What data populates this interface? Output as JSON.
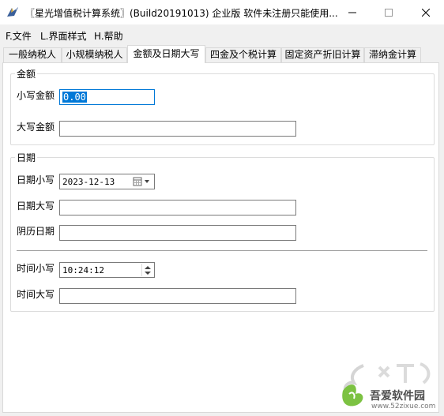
{
  "window": {
    "title": "〖星光增值税计算系统〗(Build20191013) 企业版 软件未注册只能使用...",
    "icon": "app-bird-icon"
  },
  "menu": {
    "items": [
      {
        "label": "F.文件"
      },
      {
        "label": "L.界面样式"
      },
      {
        "label": "H.帮助"
      }
    ]
  },
  "tabs": [
    {
      "label": "一般纳税人",
      "active": false
    },
    {
      "label": "小规模纳税人",
      "active": false
    },
    {
      "label": "金额及日期大写",
      "active": true
    },
    {
      "label": "四金及个税计算",
      "active": false
    },
    {
      "label": "固定资产折旧计算",
      "active": false
    },
    {
      "label": "滞纳金计算",
      "active": false
    }
  ],
  "amount_group": {
    "title": "金额",
    "lower_label": "小写金额",
    "lower_value": "0.00",
    "upper_label": "大写金额",
    "upper_value": ""
  },
  "date_group": {
    "title": "日期",
    "date_lower_label": "日期小写",
    "date_lower_value": "2023-12-13",
    "date_upper_label": "日期大写",
    "date_upper_value": "",
    "lunar_label": "阴历日期",
    "lunar_value": "",
    "time_lower_label": "时间小写",
    "time_lower_value": "10:24:12",
    "time_upper_label": "时间大写",
    "time_upper_value": ""
  },
  "watermark": {
    "site_name": "吾爱软件园",
    "site_url": "www.52zixue.com"
  },
  "colors": {
    "accent": "#0078d7",
    "border": "#7a7a7a"
  }
}
